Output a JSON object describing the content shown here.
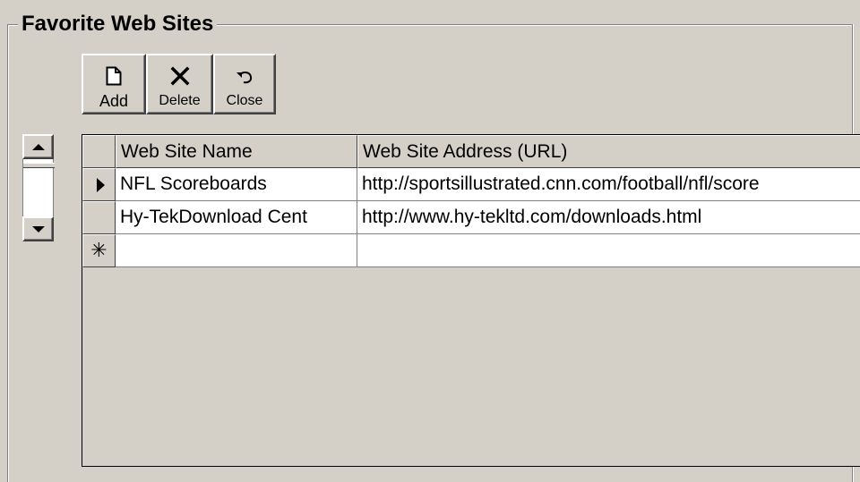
{
  "group": {
    "title": "Favorite Web Sites"
  },
  "toolbar": {
    "add": {
      "label": "Add",
      "icon": "new-page-icon"
    },
    "delete": {
      "label": "Delete",
      "icon": "x-delete-icon"
    },
    "close": {
      "label": "Close",
      "icon": "undo-arrow-icon"
    }
  },
  "table": {
    "columns": [
      "Web Site Name",
      "Web Site Address (URL)"
    ],
    "rows": [
      {
        "selector": "current-record-arrow",
        "name": "NFL Scoreboards",
        "url": "http://sportsillustrated.cnn.com/football/nfl/score"
      },
      {
        "selector": "",
        "name": "Hy-TekDownload Cent",
        "url": "http://www.hy-tekltd.com/downloads.html"
      },
      {
        "selector": "new-record-star",
        "name": "",
        "url": ""
      }
    ],
    "new_record_glyph": "✳"
  },
  "colors": {
    "face": "#d4d0c8",
    "highlight": "#ffffff",
    "shadow": "#808080",
    "dark_shadow": "#404040",
    "cell_bg": "#ffffff"
  }
}
